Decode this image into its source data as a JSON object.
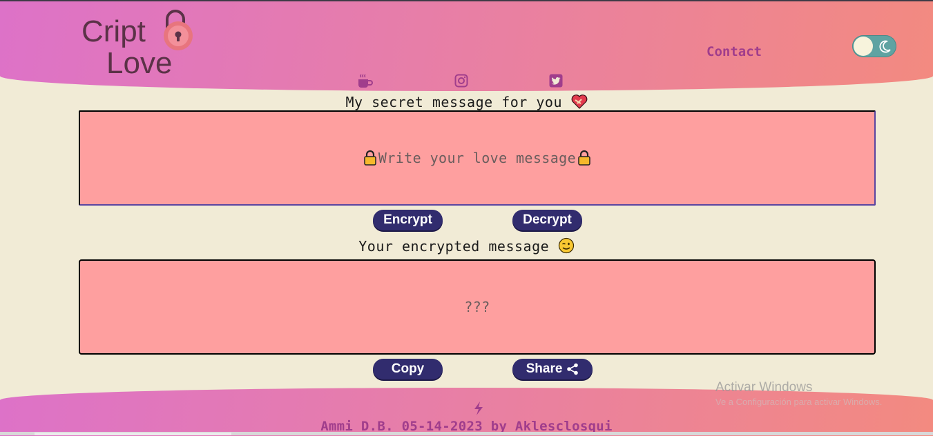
{
  "logo": {
    "line1": "Cript",
    "line2": "Love"
  },
  "nav": {
    "contact": "Contact"
  },
  "theme_toggle": {
    "state": "light"
  },
  "social_icons": [
    "coffee-icon",
    "instagram-icon",
    "twitter-icon"
  ],
  "input_section": {
    "title": "My secret message for you",
    "title_emoji": "❤️‍🩹",
    "placeholder": "Write your love message",
    "placeholder_emoji": "🔒"
  },
  "actions": {
    "encrypt": "Encrypt",
    "decrypt": "Decrypt"
  },
  "output_section": {
    "title": "Your encrypted message",
    "title_emoji": "😉",
    "placeholder": "???"
  },
  "output_actions": {
    "copy": "Copy",
    "share": "Share"
  },
  "footer": {
    "text": "Ammi D.B. 05-14-2023 by Aklesclosqui"
  },
  "os_watermark": {
    "line1": "Activar Windows",
    "line2": "Ve a Configuración para activar Windows."
  },
  "colors": {
    "header_gradient_start": "#dd72c8",
    "header_gradient_end": "#f38a80",
    "background": "#f1ebd6",
    "box_fill": "#fe9f9f",
    "button": "#312c6e",
    "accent_text": "#a03d8c"
  }
}
